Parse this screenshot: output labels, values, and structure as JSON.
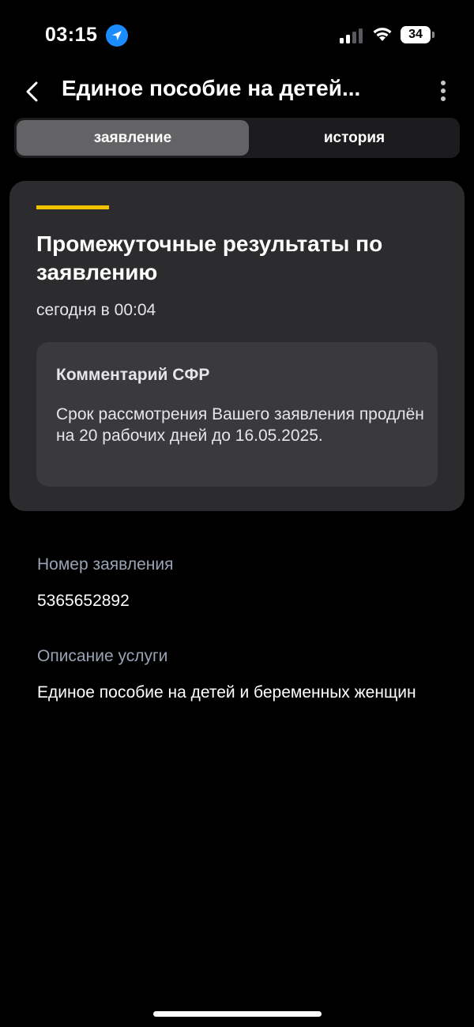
{
  "status_bar": {
    "time": "03:15",
    "battery": "34",
    "icons": [
      "location-arrow-icon",
      "cellular-signal-icon",
      "wifi-icon",
      "battery-icon"
    ]
  },
  "header": {
    "title": "Единое пособие на детей...",
    "back_icon": "chevron-left-icon",
    "more_icon": "more-vertical-icon"
  },
  "tabs": [
    {
      "label": "заявление",
      "active": true
    },
    {
      "label": "история",
      "active": false
    }
  ],
  "result_card": {
    "title": "Промежуточные результаты по заявлению",
    "date": "сегодня в 00:04",
    "accent_color": "#f2c200",
    "comment": {
      "title": "Комментарий СФР",
      "text": "Срок рассмотрения Вашего заявления продлён на 20 рабочих дней до 16.05.2025."
    }
  },
  "fields": [
    {
      "label": "Номер заявления",
      "value": "5365652892"
    },
    {
      "label": "Описание услуги",
      "value": "Единое пособие на детей и беременных женщин"
    }
  ]
}
